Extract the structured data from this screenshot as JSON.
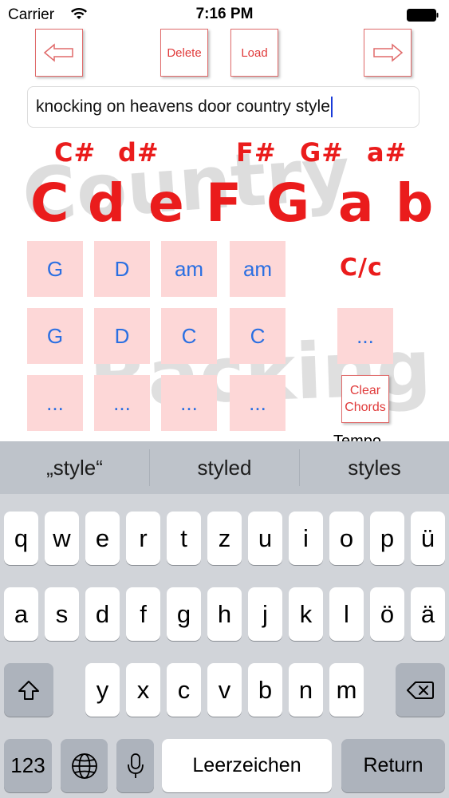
{
  "status": {
    "carrier": "Carrier",
    "time": "7:16 PM"
  },
  "toolbar": {
    "delete_label": "Delete",
    "load_label": "Load"
  },
  "song_title": {
    "value": "knocking on heavens door country style"
  },
  "notes": {
    "sharps": [
      "C#",
      "d#",
      "F#",
      "G#",
      "a#"
    ],
    "naturals": [
      "C",
      "d",
      "e",
      "F",
      "G",
      "a",
      "b"
    ],
    "watermark_top": "Country",
    "watermark_bottom": "Backing"
  },
  "grid": {
    "rows": [
      [
        "G",
        "D",
        "am",
        "am"
      ],
      [
        "G",
        "D",
        "C",
        "C"
      ],
      [
        "...",
        "...",
        "...",
        "..."
      ]
    ],
    "side_label": "C/c",
    "side_cell": "...",
    "clear_label_1": "Clear",
    "clear_label_2": "Chords",
    "tempo_label": "Tempo"
  },
  "keyboard": {
    "suggestions": [
      "„style“",
      "styled",
      "styles"
    ],
    "row1": [
      "q",
      "w",
      "e",
      "r",
      "t",
      "z",
      "u",
      "i",
      "o",
      "p",
      "ü"
    ],
    "row2": [
      "a",
      "s",
      "d",
      "f",
      "g",
      "h",
      "j",
      "k",
      "l",
      "ö",
      "ä"
    ],
    "row3": [
      "y",
      "x",
      "c",
      "v",
      "b",
      "n",
      "m"
    ],
    "numbers_label": "123",
    "space_label": "Leerzeichen",
    "return_label": "Return"
  }
}
